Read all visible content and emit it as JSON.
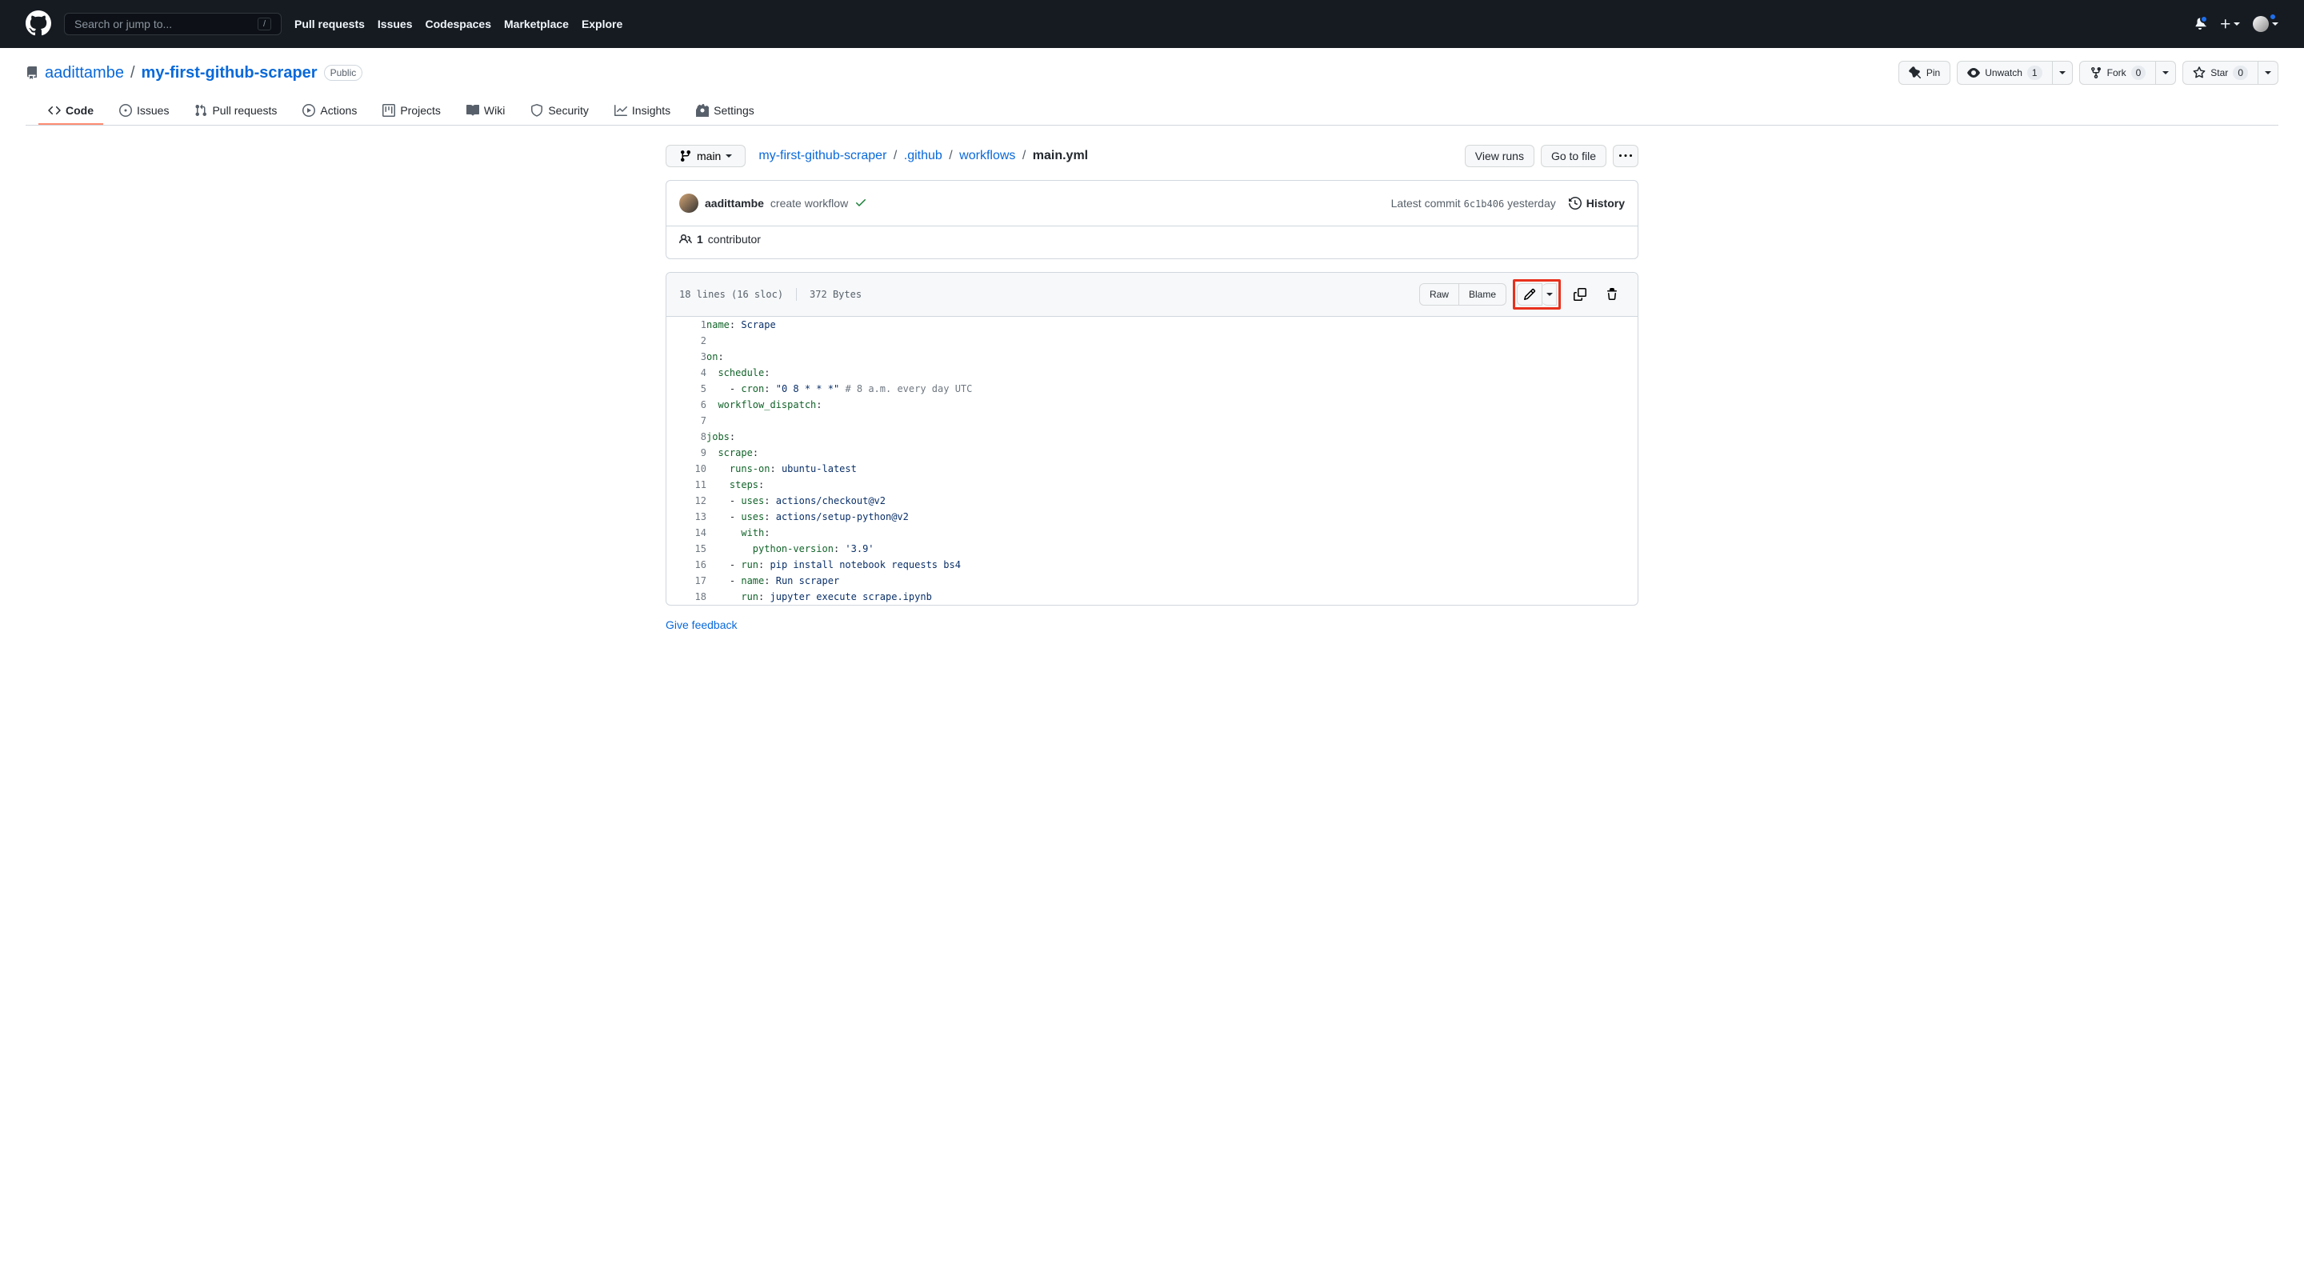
{
  "header": {
    "search_placeholder": "Search or jump to...",
    "slash": "/",
    "nav": {
      "pull_requests": "Pull requests",
      "issues": "Issues",
      "codespaces": "Codespaces",
      "marketplace": "Marketplace",
      "explore": "Explore"
    }
  },
  "repo": {
    "owner": "aadittambe",
    "name": "my-first-github-scraper",
    "visibility": "Public",
    "actions": {
      "pin": "Pin",
      "unwatch": "Unwatch",
      "unwatch_count": "1",
      "fork": "Fork",
      "fork_count": "0",
      "star": "Star",
      "star_count": "0"
    },
    "tabs": {
      "code": "Code",
      "issues": "Issues",
      "pull_requests": "Pull requests",
      "actions": "Actions",
      "projects": "Projects",
      "wiki": "Wiki",
      "security": "Security",
      "insights": "Insights",
      "settings": "Settings"
    }
  },
  "file_nav": {
    "branch": "main",
    "breadcrumb": {
      "root": "my-first-github-scraper",
      "p1": ".github",
      "p2": "workflows",
      "file": "main.yml"
    },
    "view_runs": "View runs",
    "go_to_file": "Go to file"
  },
  "commit": {
    "author": "aadittambe",
    "message": "create workflow",
    "latest_label": "Latest commit",
    "sha": "6c1b406",
    "time": "yesterday",
    "history": "History",
    "contributor_count": "1",
    "contributor_label": "contributor"
  },
  "file": {
    "lines_sloc": "18 lines (16 sloc)",
    "size": "372 Bytes",
    "raw": "Raw",
    "blame": "Blame"
  },
  "code": {
    "lines": [
      {
        "n": "1",
        "html": "<span class=\"pl-ent\">name</span>: <span class=\"pl-s\">Scrape</span>"
      },
      {
        "n": "2",
        "html": ""
      },
      {
        "n": "3",
        "html": "<span class=\"pl-ent\">on</span>:"
      },
      {
        "n": "4",
        "html": "  <span class=\"pl-ent\">schedule</span>:"
      },
      {
        "n": "5",
        "html": "    - <span class=\"pl-ent\">cron</span>: <span class=\"pl-s\">\"0 8 * * *\"</span> <span class=\"pl-c\"># 8 a.m. every day UTC</span>"
      },
      {
        "n": "6",
        "html": "  <span class=\"pl-ent\">workflow_dispatch</span>:"
      },
      {
        "n": "7",
        "html": ""
      },
      {
        "n": "8",
        "html": "<span class=\"pl-ent\">jobs</span>:"
      },
      {
        "n": "9",
        "html": "  <span class=\"pl-ent\">scrape</span>:"
      },
      {
        "n": "10",
        "html": "    <span class=\"pl-ent\">runs-on</span>: <span class=\"pl-s\">ubuntu-latest</span>"
      },
      {
        "n": "11",
        "html": "    <span class=\"pl-ent\">steps</span>:"
      },
      {
        "n": "12",
        "html": "    - <span class=\"pl-ent\">uses</span>: <span class=\"pl-s\">actions/checkout@v2</span>"
      },
      {
        "n": "13",
        "html": "    - <span class=\"pl-ent\">uses</span>: <span class=\"pl-s\">actions/setup-python@v2</span>"
      },
      {
        "n": "14",
        "html": "      <span class=\"pl-ent\">with</span>:"
      },
      {
        "n": "15",
        "html": "        <span class=\"pl-ent\">python-version</span>: <span class=\"pl-s\">'3.9'</span>"
      },
      {
        "n": "16",
        "html": "    - <span class=\"pl-ent\">run</span>: <span class=\"pl-s\">pip install notebook requests bs4</span>"
      },
      {
        "n": "17",
        "html": "    - <span class=\"pl-ent\">name</span>: <span class=\"pl-s\">Run scraper</span>"
      },
      {
        "n": "18",
        "html": "      <span class=\"pl-ent\">run</span>: <span class=\"pl-s\">jupyter execute scrape.ipynb</span>"
      }
    ]
  },
  "feedback": "Give feedback"
}
